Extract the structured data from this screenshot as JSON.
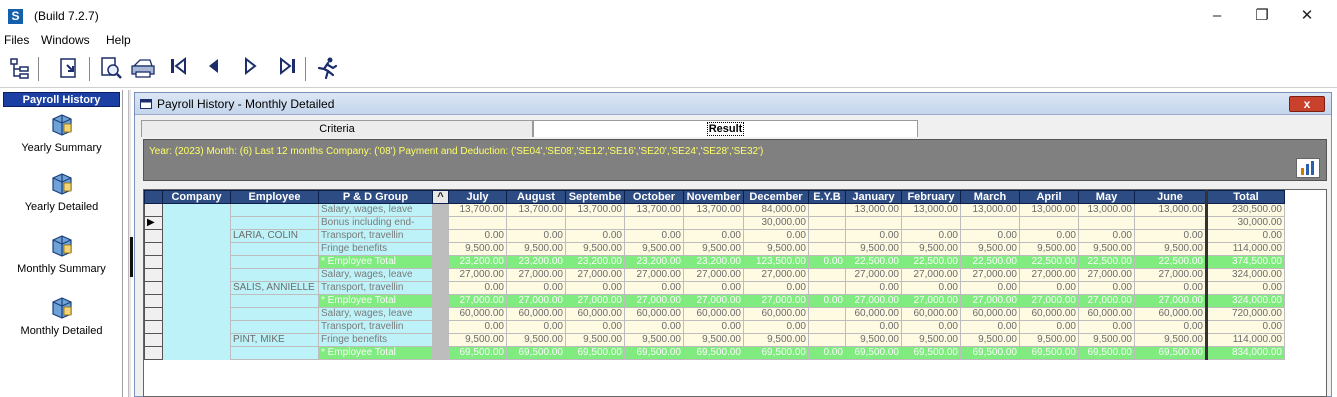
{
  "window": {
    "title": "(Build 7.2.7)",
    "logo": "S"
  },
  "menu": [
    "Files",
    "Windows",
    "Help"
  ],
  "toolbar_icons": [
    "tree-icon",
    "import-icon",
    "preview-icon",
    "print-icon",
    "first-record-icon",
    "previous-record-icon",
    "next-record-icon",
    "last-record-icon",
    "run-icon"
  ],
  "left_panel": {
    "header": "Payroll History",
    "items": [
      {
        "label": "Yearly Summary"
      },
      {
        "label": "Yearly Detailed"
      },
      {
        "label": "Monthly Summary"
      },
      {
        "label": "Monthly Detailed"
      }
    ]
  },
  "child": {
    "title": "Payroll History - Monthly Detailed",
    "close": "x",
    "tabs": {
      "criteria": "Criteria",
      "result": "Result"
    },
    "info": "Year: (2023) Month: (6) Last 12 months Company: ('08') Payment and Deduction: ('SE04','SE08','SE12','SE16','SE20','SE24','SE28','SE32')"
  },
  "grid": {
    "columns": [
      "Company",
      "Employee",
      "P & D Group",
      "July",
      "August",
      "Septembe",
      "October",
      "November",
      "December",
      "E.Y.B",
      "January",
      "February",
      "March",
      "April",
      "May",
      "June",
      "Total"
    ],
    "rows": [
      {
        "emp": "",
        "grp": "Salary, wages, leave",
        "vals": [
          "13,700.00",
          "13,700.00",
          "13,700.00",
          "13,700.00",
          "13,700.00",
          "84,000.00",
          "",
          "13,000.00",
          "13,000.00",
          "13,000.00",
          "13,000.00",
          "13,000.00",
          "13,000.00"
        ],
        "total": "230,500.00"
      },
      {
        "emp": "",
        "grp": "Bonus including end-",
        "vals": [
          "",
          "",
          "",
          "",
          "",
          "30,000.00",
          "",
          "",
          "",
          "",
          "",
          "",
          ""
        ],
        "total": "30,000.00"
      },
      {
        "emp": "LARIA, COLIN",
        "grp": "Transport, travellin",
        "vals": [
          "0.00",
          "0.00",
          "0.00",
          "0.00",
          "0.00",
          "0.00",
          "",
          "0.00",
          "0.00",
          "0.00",
          "0.00",
          "0.00",
          "0.00"
        ],
        "total": "0.00"
      },
      {
        "emp": "",
        "grp": "Fringe benefits",
        "vals": [
          "9,500.00",
          "9,500.00",
          "9,500.00",
          "9,500.00",
          "9,500.00",
          "9,500.00",
          "",
          "9,500.00",
          "9,500.00",
          "9,500.00",
          "9,500.00",
          "9,500.00",
          "9,500.00"
        ],
        "total": "114,000.00"
      },
      {
        "emp": "",
        "grp": "* Employee Total",
        "sub": true,
        "vals": [
          "23,200.00",
          "23,200.00",
          "23,200.00",
          "23,200.00",
          "23,200.00",
          "123,500.00",
          "0.00",
          "22,500.00",
          "22,500.00",
          "22,500.00",
          "22,500.00",
          "22,500.00",
          "22,500.00"
        ],
        "total": "374,500.00"
      },
      {
        "emp": "",
        "grp": "Salary, wages, leave",
        "vals": [
          "27,000.00",
          "27,000.00",
          "27,000.00",
          "27,000.00",
          "27,000.00",
          "27,000.00",
          "",
          "27,000.00",
          "27,000.00",
          "27,000.00",
          "27,000.00",
          "27,000.00",
          "27,000.00"
        ],
        "total": "324,000.00"
      },
      {
        "emp": "SALIS, ANNIELLE",
        "grp": "Transport, travellin",
        "vals": [
          "0.00",
          "0.00",
          "0.00",
          "0.00",
          "0.00",
          "0.00",
          "",
          "0.00",
          "0.00",
          "0.00",
          "0.00",
          "0.00",
          "0.00"
        ],
        "total": "0.00"
      },
      {
        "emp": "",
        "grp": "* Employee Total",
        "sub": true,
        "vals": [
          "27,000.00",
          "27,000.00",
          "27,000.00",
          "27,000.00",
          "27,000.00",
          "27,000.00",
          "0.00",
          "27,000.00",
          "27,000.00",
          "27,000.00",
          "27,000.00",
          "27,000.00",
          "27,000.00"
        ],
        "total": "324,000.00"
      },
      {
        "emp": "",
        "grp": "Salary, wages, leave",
        "vals": [
          "60,000.00",
          "60,000.00",
          "60,000.00",
          "60,000.00",
          "60,000.00",
          "60,000.00",
          "",
          "60,000.00",
          "60,000.00",
          "60,000.00",
          "60,000.00",
          "60,000.00",
          "60,000.00"
        ],
        "total": "720,000.00"
      },
      {
        "emp": "",
        "grp": "Transport, travellin",
        "vals": [
          "0.00",
          "0.00",
          "0.00",
          "0.00",
          "0.00",
          "0.00",
          "",
          "0.00",
          "0.00",
          "0.00",
          "0.00",
          "0.00",
          "0.00"
        ],
        "total": "0.00"
      },
      {
        "emp": "PINT, MIKE",
        "grp": "Fringe benefits",
        "vals": [
          "9,500.00",
          "9,500.00",
          "9,500.00",
          "9,500.00",
          "9,500.00",
          "9,500.00",
          "",
          "9,500.00",
          "9,500.00",
          "9,500.00",
          "9,500.00",
          "9,500.00",
          "9,500.00"
        ],
        "total": "114,000.00"
      },
      {
        "emp": "",
        "grp": "* Employee Total",
        "sub": true,
        "vals": [
          "69,500.00",
          "69,500.00",
          "69,500.00",
          "69,500.00",
          "69,500.00",
          "69,500.00",
          "0.00",
          "69,500.00",
          "69,500.00",
          "69,500.00",
          "69,500.00",
          "69,500.00",
          "69,500.00"
        ],
        "total": "834,000.00"
      }
    ],
    "scroll_up": "^"
  }
}
